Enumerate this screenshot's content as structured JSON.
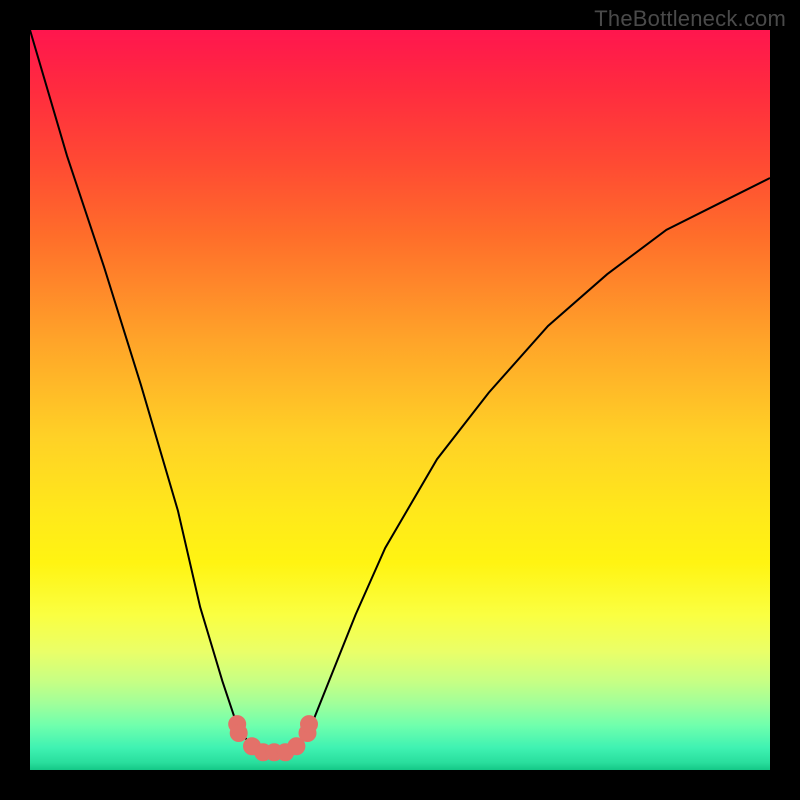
{
  "watermark": "TheBottleneck.com",
  "colors": {
    "marker": "#e37169",
    "curve": "#000000",
    "frame": "#000000"
  },
  "chart_data": {
    "type": "line",
    "title": "",
    "xlabel": "",
    "ylabel": "",
    "xlim": [
      0,
      100
    ],
    "ylim": [
      0,
      100
    ],
    "series": [
      {
        "name": "bottleneck-curve",
        "x": [
          0,
          5,
          10,
          15,
          20,
          23,
          26,
          28,
          30,
          31.5,
          33,
          34.5,
          36,
          38,
          40,
          44,
          48,
          55,
          62,
          70,
          78,
          86,
          94,
          100
        ],
        "y": [
          100,
          83,
          68,
          52,
          35,
          22,
          12,
          6,
          3,
          2,
          2,
          2,
          3,
          6,
          11,
          21,
          30,
          42,
          51,
          60,
          67,
          73,
          77,
          80
        ]
      }
    ],
    "markers": {
      "name": "highlighted-points",
      "x": [
        28,
        28.2,
        30,
        31.5,
        33,
        34.5,
        36,
        37.5,
        37.7
      ],
      "y": [
        6.2,
        5.0,
        3.2,
        2.4,
        2.4,
        2.4,
        3.2,
        5.0,
        6.2
      ]
    },
    "gradient_stops": [
      {
        "pct": 0,
        "color": "#ff164e"
      },
      {
        "pct": 50,
        "color": "#ffd126"
      },
      {
        "pct": 80,
        "color": "#faff41"
      },
      {
        "pct": 100,
        "color": "#14c786"
      }
    ]
  }
}
